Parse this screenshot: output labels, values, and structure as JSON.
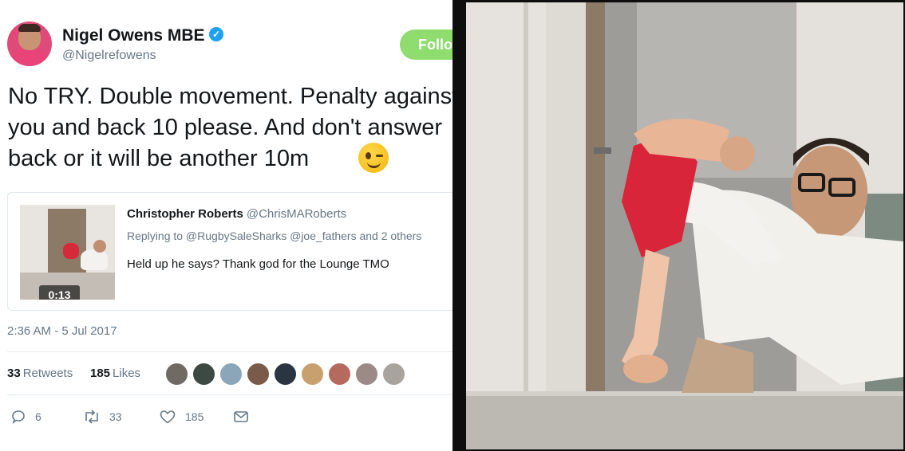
{
  "tweet": {
    "author_name": "Nigel Owens MBE",
    "verified_mark": "✓",
    "handle": "@Nigelrefowens",
    "follow_label": "Follow",
    "text_lines": [
      "No TRY. Double movement. Penalty against",
      "you and back 10 please. And don't answer",
      "back or it will be another 10m"
    ],
    "emoji_icon": "winking-face-icon",
    "quoted": {
      "author_name": "Christopher Roberts",
      "handle": "@ChrisMARoberts",
      "replying_to": "Replying to @RugbySaleSharks @joe_fathers and 2 others",
      "text": "Held up he says? Thank god for the Lounge TMO",
      "video_duration": "0:13"
    },
    "timestamp": "2:36 AM - 5 Jul 2017",
    "stats": {
      "retweets_count": "33",
      "retweets_label": "Retweets",
      "likes_count": "185",
      "likes_label": "Likes"
    },
    "liker_avatar_colors": [
      "#6f6a64",
      "#3d4a44",
      "#8aa6b8",
      "#7a5a48",
      "#2b3542",
      "#c8a070",
      "#b56a5e",
      "#9c8a86",
      "#a9a39e"
    ],
    "actions": {
      "reply_count": "6",
      "retweet_count": "33",
      "like_count": "185"
    },
    "colors": {
      "follow_green": "#8fdc6f",
      "verified_blue": "#1da1f2",
      "secondary_text": "#657786"
    }
  }
}
